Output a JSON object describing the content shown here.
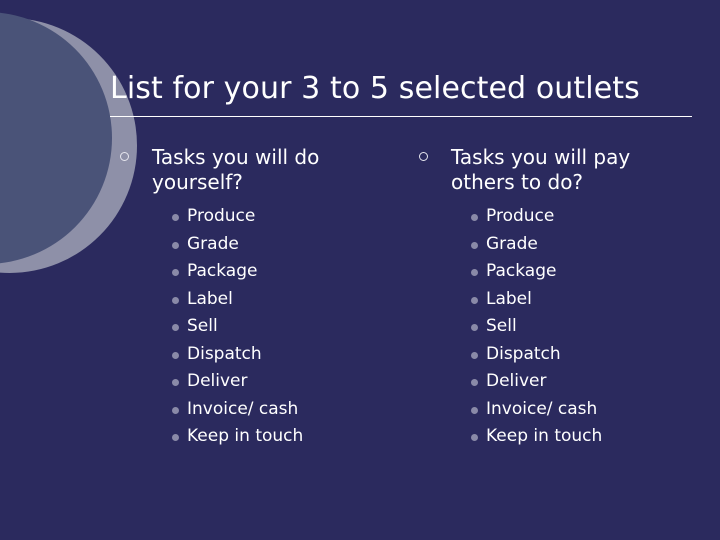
{
  "slide": {
    "title": "List for your 3 to 5 selected outlets",
    "background_color": "#2b2a5e",
    "text_color": "#ffffff"
  },
  "decor": {
    "circle_dark_color": "#4a5378",
    "circle_light_color": "#8e90a8"
  },
  "bullets": {
    "level1_glyph": "hollow-circle",
    "level2_glyph": "filled-circle",
    "level2_color": "#8a8aa8"
  },
  "columns": [
    {
      "heading": "Tasks you will do yourself?",
      "items": [
        "Produce",
        "Grade",
        "Package",
        "Label",
        "Sell",
        "Dispatch",
        "Deliver",
        "Invoice/ cash",
        "Keep in touch"
      ]
    },
    {
      "heading": "Tasks you will pay others to do?",
      "items": [
        "Produce",
        "Grade",
        "Package",
        "Label",
        "Sell",
        "Dispatch",
        "Deliver",
        "Invoice/ cash",
        "Keep in touch"
      ]
    }
  ]
}
